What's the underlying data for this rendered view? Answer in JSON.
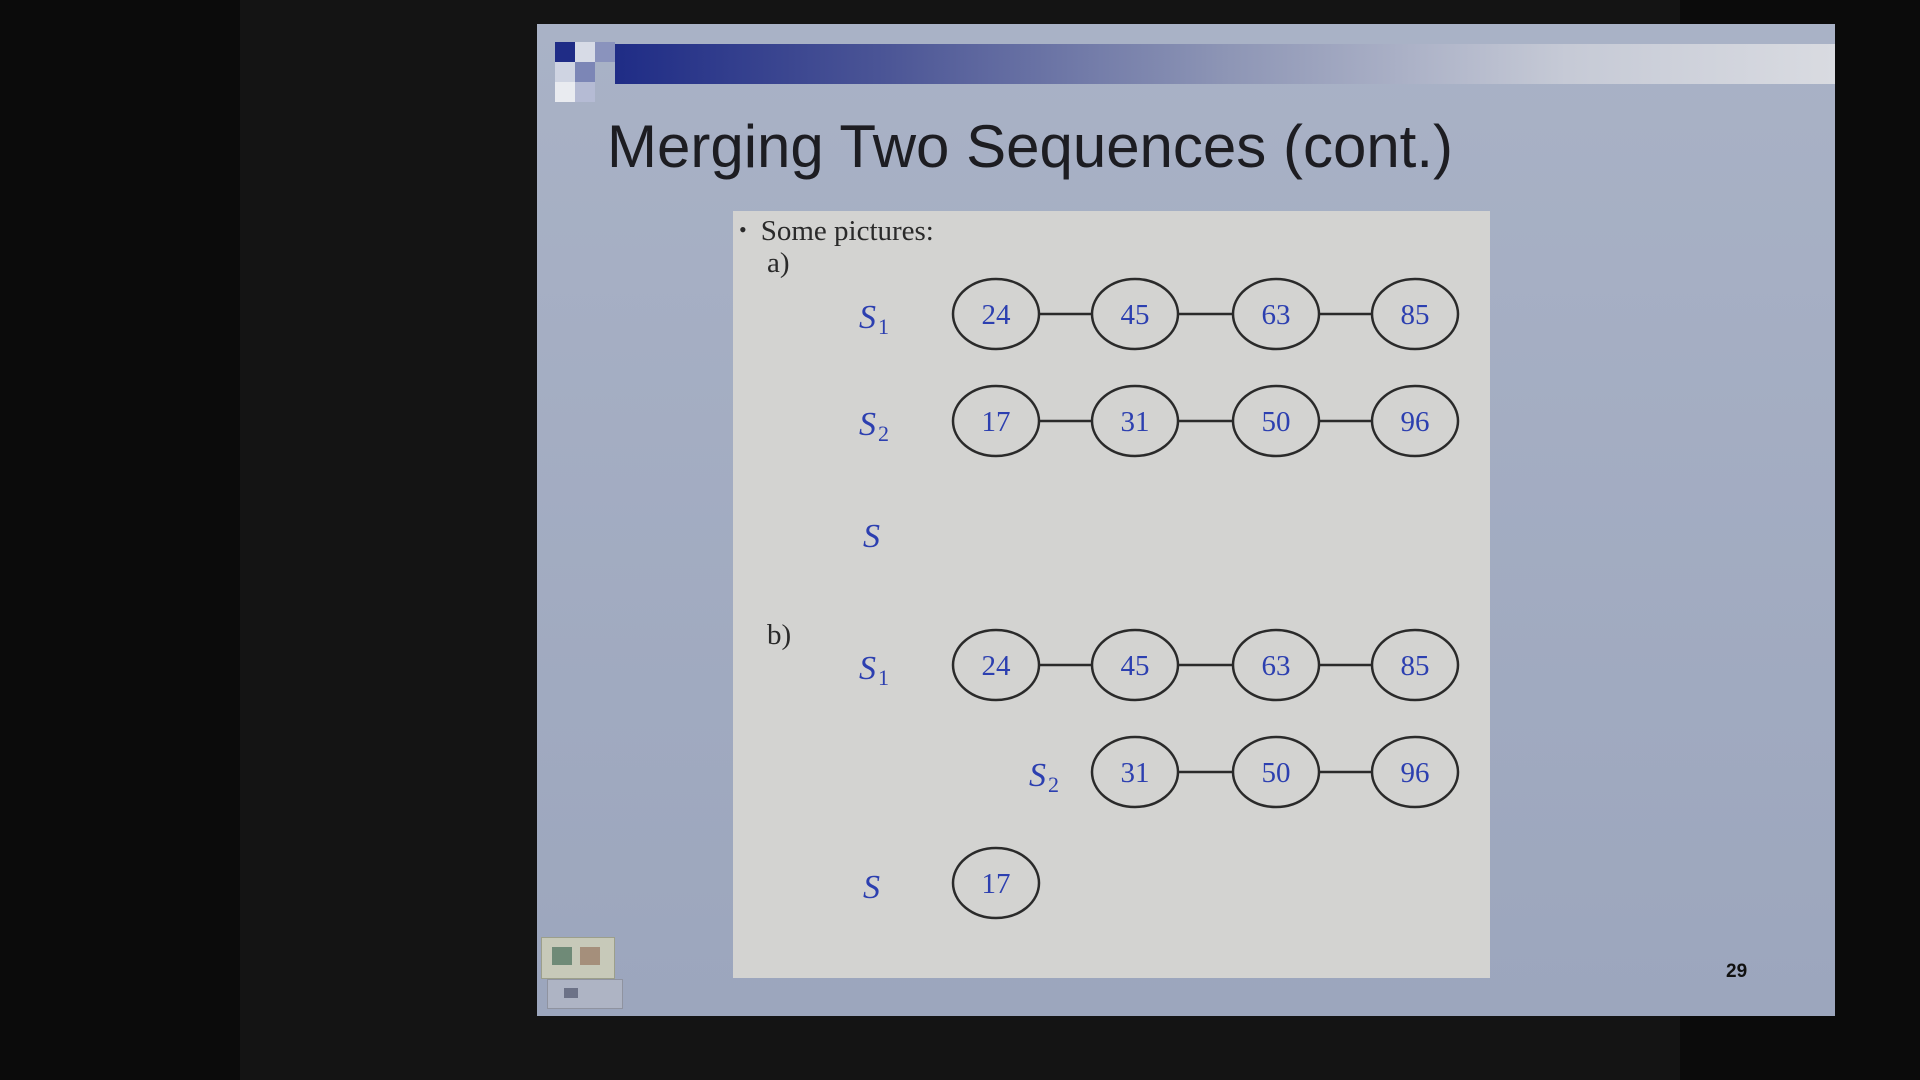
{
  "slide": {
    "title": "Merging Two Sequences (cont.)",
    "page_number": "29"
  },
  "figure": {
    "bullet": "Some pictures:",
    "section_a": {
      "label": "a)",
      "s1_label": "S",
      "s1_sub": "1",
      "s2_label": "S",
      "s2_sub": "2",
      "s_label": "S",
      "s1_nodes": [
        "24",
        "45",
        "63",
        "85"
      ],
      "s2_nodes": [
        "17",
        "31",
        "50",
        "96"
      ],
      "s_nodes": []
    },
    "section_b": {
      "label": "b)",
      "s1_label": "S",
      "s1_sub": "1",
      "s2_label": "S",
      "s2_sub": "2",
      "s_label": "S",
      "s1_nodes": [
        "24",
        "45",
        "63",
        "85"
      ],
      "s2_nodes": [
        "31",
        "50",
        "96"
      ],
      "s_nodes": [
        "17"
      ]
    }
  },
  "colors": {
    "node_text": "#2c3fb0",
    "node_outline": "#2a2a2a",
    "figure_background": "#d3d3d1",
    "slide_background": "#a9b2c6"
  },
  "icons": [
    "slideshow-control-icon",
    "navigation-control-icon"
  ]
}
